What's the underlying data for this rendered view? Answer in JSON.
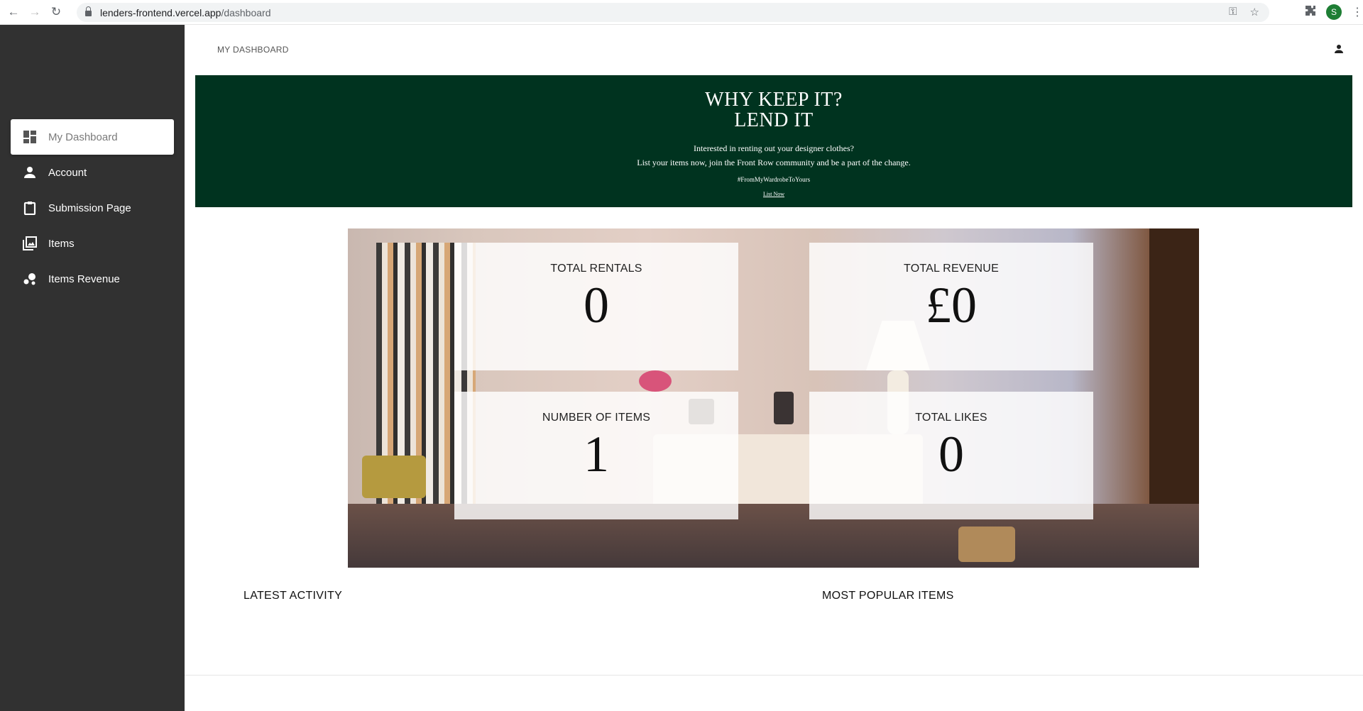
{
  "browser": {
    "url_host": "lenders-frontend.vercel.app",
    "url_path": "/dashboard",
    "profile_initial": "S",
    "icons": [
      "back-arrow-icon",
      "forward-arrow-icon",
      "reload-icon",
      "lock-icon",
      "key-icon",
      "star-icon",
      "puzzle-icon",
      "kebab-menu-icon"
    ]
  },
  "sidebar": {
    "items": [
      {
        "label": "My Dashboard",
        "icon": "dashboard-icon",
        "active": true
      },
      {
        "label": "Account",
        "icon": "person-icon",
        "active": false
      },
      {
        "label": "Submission Page",
        "icon": "clipboard-icon",
        "active": false
      },
      {
        "label": "Items",
        "icon": "image-gallery-icon",
        "active": false
      },
      {
        "label": "Items Revenue",
        "icon": "bubble-chart-icon",
        "active": false
      }
    ]
  },
  "header": {
    "breadcrumb": "MY DASHBOARD"
  },
  "banner": {
    "title_line1": "WHY KEEP IT?",
    "title_line2": "LEND IT",
    "line1": "Interested in renting out your designer clothes?",
    "line2": "List your items now, join the Front Row community and be a part of the change.",
    "hashtag": "#FromMyWardrobeToYours",
    "cta": "List Now",
    "background": "#00331f"
  },
  "stats": [
    {
      "label": "TOTAL RENTALS",
      "value": "0"
    },
    {
      "label": "TOTAL REVENUE",
      "value": "£0"
    },
    {
      "label": "NUMBER OF ITEMS",
      "value": "1"
    },
    {
      "label": "TOTAL LIKES",
      "value": "0"
    }
  ],
  "sections": {
    "latest_activity": "LATEST ACTIVITY",
    "most_popular": "MOST POPULAR ITEMS"
  },
  "colors": {
    "sidebar": "#313131",
    "banner": "#00331f",
    "profile": "#1e7e34"
  }
}
